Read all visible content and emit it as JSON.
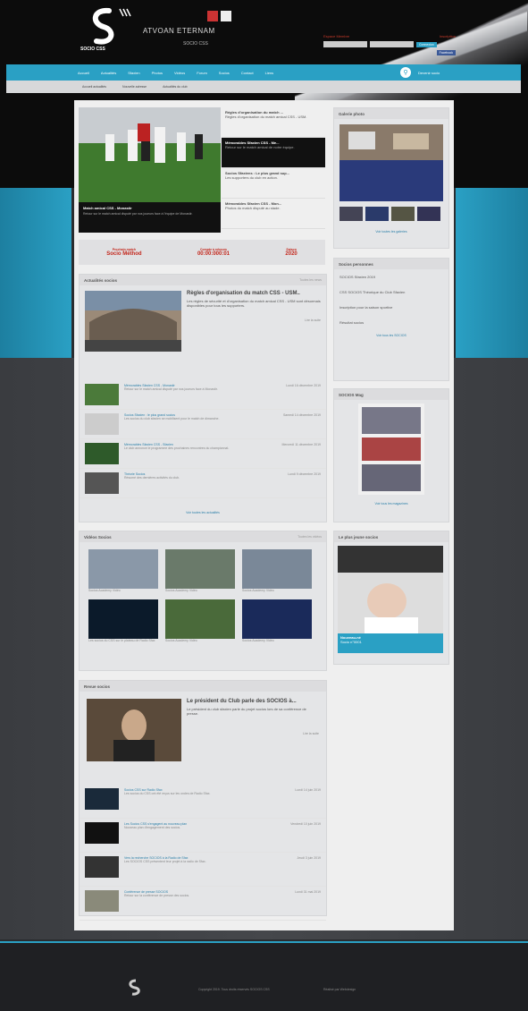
{
  "header": {
    "brand_title": "ATVOAN ETERNAM",
    "brand_sub": "SOCIO CSS",
    "login": {
      "label_left": "Espace Membre",
      "label_right": "Inscription",
      "user_placeholder": "",
      "pass_placeholder": "",
      "login_button": "Connexion",
      "facebook_button": "Facebook"
    }
  },
  "nav": {
    "items": [
      "Accueil",
      "Actualités",
      "Sfaxien",
      "Photos",
      "Vidéos",
      "Forum",
      "Socios",
      "Contact",
      "Liens"
    ],
    "right_link": "Devenir socio"
  },
  "subnav": {
    "items": [
      "Accueil actualités",
      "Nouvelle adresse",
      "Actualités du club"
    ]
  },
  "slideshow": {
    "caption_title": "Match amical CSS - Monastir",
    "caption_text": "Retour sur le match amical disputé par nos joueurs face à l'équipe de Monastir.",
    "list": [
      {
        "title": "Régles d'organisation du match ...",
        "text": "Règles d'organisation du match amical CSS - USM."
      },
      {
        "title": "Mémorables Sfaxien CSS - Me...",
        "text": "Retour sur le match amical de notre équipe."
      },
      {
        "title": "Socios Sfaxiens : Le plus grand sup...",
        "text": "Les supporters du club en action."
      },
      {
        "title": "Mémorables Sfaxien CSS - Mon...",
        "text": "Photos du match disputé au stade."
      }
    ]
  },
  "countdown": [
    {
      "label": "Prochain match",
      "value": "Socio Méthod"
    },
    {
      "label": "Compte à rebours",
      "value": "00:00:000:01"
    },
    {
      "label": "Saison",
      "value": "2020"
    }
  ],
  "actualites": {
    "title": "Actualités socios",
    "more": "Toutes les news",
    "feature_title": "Règles d'organisation du match CSS - USM..",
    "feature_text": "Les règles de sécurité et d'organisation du match amical CSS - USM sont désormais disponibles pour tous les supporters.",
    "read_more": "Lire la suite",
    "items": [
      {
        "title": "Mémorables Sfaxien CSS - Monastir",
        "date": "Lundi 16 décembre 2019",
        "text": "Retour sur le match amical disputé par nos joueurs face à Monastir."
      },
      {
        "title": "Socios Sfaxien : le plus grand socios",
        "date": "Samedi 14 décembre 2019",
        "text": "Les socios du club sfaxien se mobilisent pour le match de dimanche."
      },
      {
        "title": "Mémorables Sfaxien CSS - Sfaxien",
        "date": "Mercredi 11 décembre 2019",
        "text": "Le club annonce le programme des prochaines rencontres du championnat."
      },
      {
        "title": "Théorie Socios",
        "date": "Lundi 9 décembre 2019",
        "text": "Résumé des dernières activités du club."
      }
    ],
    "footer_link": "Voir toutes les actualités"
  },
  "videos": {
    "title": "Vidéos Socios",
    "more": "Toutes les vidéos",
    "items": [
      {
        "caption": "Socios Academy Vidéo"
      },
      {
        "caption": "Socios Academy Vidéo"
      },
      {
        "caption": "Socios Academy Vidéo"
      },
      {
        "caption": "Les socios du CSS sur le plateau de Radio Sfax"
      },
      {
        "caption": "Socios Academy Vidéo"
      },
      {
        "caption": "Socios Academy Vidéo"
      }
    ]
  },
  "revue": {
    "title": "Revue socios",
    "feature_title": "Le président du Club parle des SOCIOS à...",
    "feature_text": "Le président du club sfaxien parle du projet socios lors de sa conférence de presse.",
    "read_more": "Lire la suite",
    "items": [
      {
        "title": "Socios CSS sur Radio Sfax",
        "date": "Lundi 14 juin 2019",
        "text": "Les socios du CSS ont été reçus sur les ondes de Radio Sfax."
      },
      {
        "title": "Les Socios CSS s'engagent au nouveau plan",
        "date": "Vendredi 10 juin 2019",
        "text": "Nouveau plan d'engagement des socios."
      },
      {
        "title": "Vers la recherche SOCIOS à la Radio de Sfax",
        "date": "Jeudi 3 juin 2019",
        "text": "Les SOCIOS CSS présentent leur projet à la radio de Sfax."
      },
      {
        "title": "Conférence de presse SOCIOS",
        "date": "Lundi 31 mai 2019",
        "text": "Retour sur la conférence de presse des socios."
      }
    ]
  },
  "sidebar": {
    "gallery_title": "Galerie photo",
    "gallery_link": "Voir toutes les galeries",
    "socios_title": "Socios personnes",
    "socios_items": [
      "SOCIOS Sfaxien 2019",
      "CSS SOCIOS Théorique du Club Sfaxien",
      "Inscription pour la saison sportive",
      "Résultat socios"
    ],
    "socios_link": "Voir tous les SOCIOS",
    "mag_title": "SOCIOS Mag",
    "mag_link": "Voir tous les magazines",
    "popular_title": "Le plus jeune socios",
    "popular_caption_name": "Nouveau-né",
    "popular_caption_sub": "Socio n°0001"
  },
  "footer": {
    "copyright": "Copyright 2019. Tous droits réservés SOCIOS CSS",
    "credit": "Réalisé par Webdesign"
  },
  "colors": {
    "accent": "#2aa0c4",
    "red": "#c3271c",
    "dark": "#0c0c0c"
  }
}
